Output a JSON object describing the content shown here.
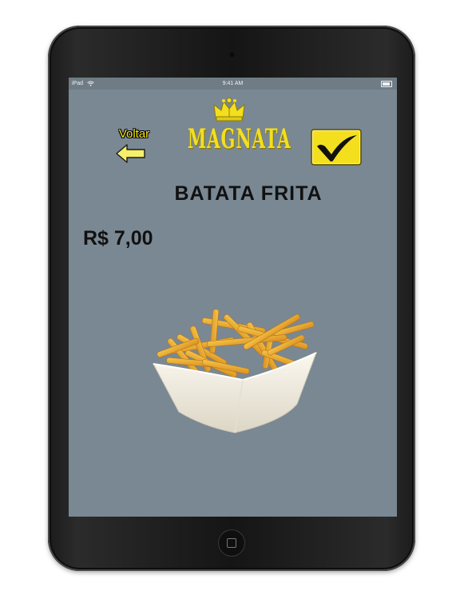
{
  "status_bar": {
    "carrier": "iPad",
    "time": "9:41 AM"
  },
  "header": {
    "back_label": "Voltar",
    "logo_text": "MAGNATA",
    "confirm_icon": "checkmark-icon",
    "back_icon": "arrow-left-icon",
    "accent_color": "#f3df1e"
  },
  "product": {
    "name": "BATATA FRITA",
    "price": "R$ 7,00",
    "image": "french-fries-photo"
  },
  "colors": {
    "screen_background": "#7a8893",
    "text": "#111111"
  }
}
